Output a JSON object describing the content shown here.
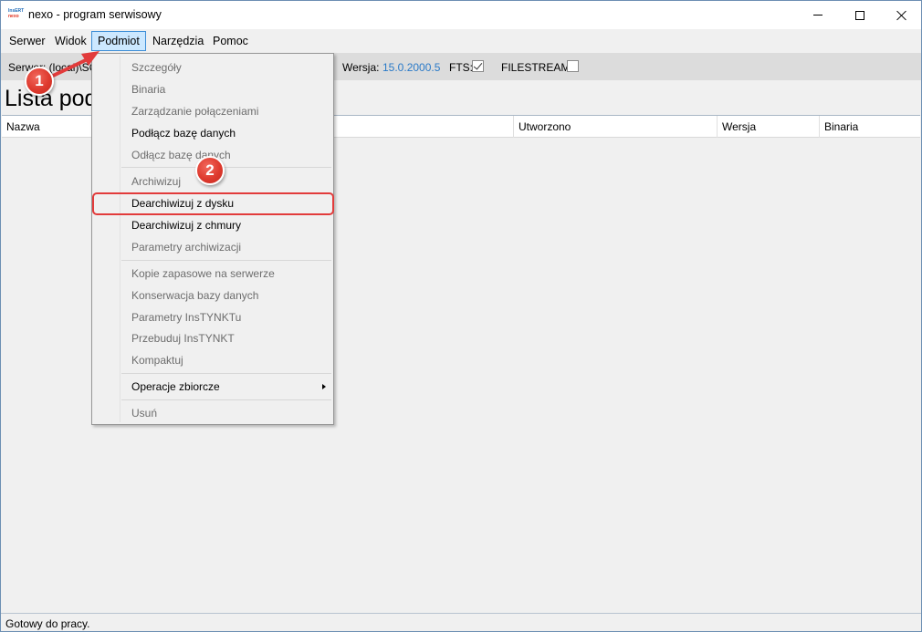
{
  "window": {
    "title": "nexo - program serwisowy",
    "icon_text_top": "InsERT",
    "icon_text_bottom": "nexo"
  },
  "menubar": {
    "items": [
      {
        "label": "Serwer"
      },
      {
        "label": "Widok"
      },
      {
        "label": "Podmiot"
      },
      {
        "label": "Narzędzia"
      },
      {
        "label": "Pomoc"
      }
    ]
  },
  "infobar": {
    "server_label": "Serwer: (local)\\SQ",
    "version_label": "Wersja:",
    "version_value": "15.0.2000.5",
    "fts_label": "FTS:",
    "fts_checked": true,
    "filestream_label": "FILESTREAM:",
    "filestream_checked": false
  },
  "page_title": "Lista pod",
  "grid": {
    "columns": [
      {
        "label": "Nazwa"
      },
      {
        "label": "Utworzono"
      },
      {
        "label": "Wersja"
      },
      {
        "label": "Binaria"
      }
    ]
  },
  "dropdown": {
    "items": [
      {
        "label": "Szczegóły",
        "enabled": false
      },
      {
        "label": "Binaria",
        "enabled": false
      },
      {
        "label": "Zarządzanie połączeniami",
        "enabled": false
      },
      {
        "label": "Podłącz bazę danych",
        "enabled": true
      },
      {
        "label": "Odłącz bazę danych",
        "enabled": false
      },
      {
        "label": "Archiwizuj",
        "enabled": false
      },
      {
        "label": "Dearchiwizuj z dysku",
        "enabled": true
      },
      {
        "label": "Dearchiwizuj z chmury",
        "enabled": true
      },
      {
        "label": "Parametry archiwizacji",
        "enabled": false
      },
      {
        "label": "Kopie zapasowe na serwerze",
        "enabled": false
      },
      {
        "label": "Konserwacja bazy danych",
        "enabled": false
      },
      {
        "label": "Parametry InsTYNKTu",
        "enabled": false
      },
      {
        "label": "Przebuduj InsTYNKT",
        "enabled": false
      },
      {
        "label": "Kompaktuj",
        "enabled": false
      },
      {
        "label": "Operacje zbiorcze",
        "enabled": true
      },
      {
        "label": "Usuń",
        "enabled": false
      }
    ]
  },
  "status": "Gotowy do pracy.",
  "annotations": {
    "badge1": "1",
    "badge2": "2",
    "accent_color": "#e23b3b"
  }
}
